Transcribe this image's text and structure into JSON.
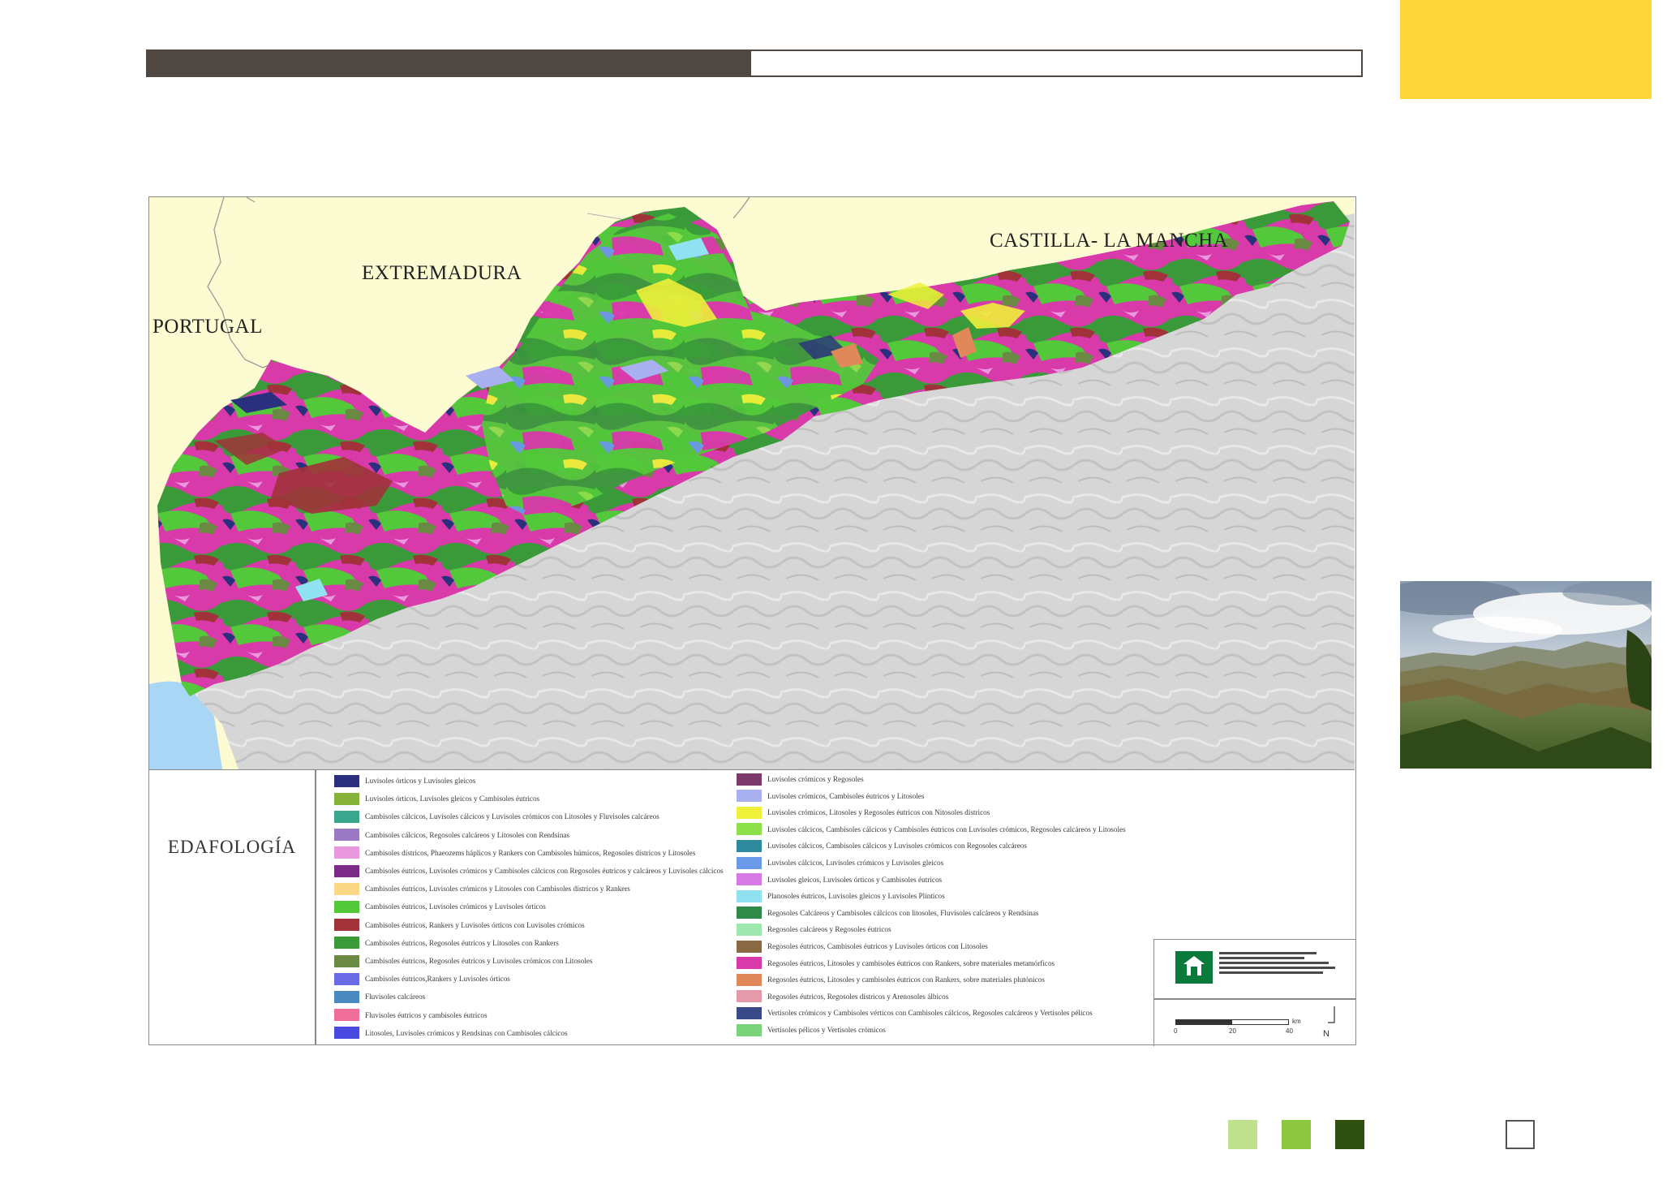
{
  "page": {
    "colors": {
      "top_bar_dark": "#4e4742",
      "accent_yellow": "#fed63a",
      "square_light": "#bfe08c",
      "square_mid": "#8dc63f",
      "square_dark": "#2f5011"
    },
    "top_progress": 0.497
  },
  "map": {
    "labels": {
      "portugal": "PORTUGAL",
      "extremadura": "EXTREMADURA",
      "castilla": "CASTILLA- LA MANCHA"
    },
    "colors": {
      "neighbour_land": "#fdfbd2",
      "sea": "#a9d6f5",
      "relief": "#d7d7d7"
    }
  },
  "legend": {
    "title": "EDAFOLOGÍA",
    "left": [
      {
        "label": "Luvisoles órticos y Luvisoles gleicos",
        "color": "#2a2f7e"
      },
      {
        "label": "Luvisoles órticos, Luvisoles gleicos y Cambisoles éutricos",
        "color": "#86b23a"
      },
      {
        "label": "Cambisoles cálcicos, Luvisoles cálcicos y Luvisoles crómicos con Litosoles y Fluvisoles calcáreos",
        "color": "#3aa68c"
      },
      {
        "label": "Cambisoles cálcicos, Regosoles calcáreos y Litosoles con Rendsinas",
        "color": "#9a7ac2"
      },
      {
        "label": "Cambisoles dístricos, Phaeozems háplicos y Rankers con Cambisoles húmicos, Regosoles dístricos y Litosoles",
        "color": "#ea98de"
      },
      {
        "label": "Cambisoles éutricos, Luvisoles crómicos y Cambisoles cálcicos con Regosoles éutricos y calcáreos y Luvisoles cálcicos",
        "color": "#7b2a88"
      },
      {
        "label": "Cambisoles éutricos, Luvisoles crómicos y Litosoles con Cambisoles dístricos y Rankers",
        "color": "#fbd886"
      },
      {
        "label": "Cambisoles éutricos, Luvisoles crómicos y Luvisoles órticos",
        "color": "#52c83a"
      },
      {
        "label": "Cambisoles éutricos, Rankers y Luvisoles órticos con Luvisoles crómicos",
        "color": "#a1323a"
      },
      {
        "label": "Cambisoles éutricos, Regosoles éutricos y Litosoles con Rankers",
        "color": "#3a9a3a"
      },
      {
        "label": "Cambisoles éutricos, Regosoles éutricos y Luvisoles crómicos con Litosoles",
        "color": "#6a8a44"
      },
      {
        "label": "Cambisoles éutricos,Rankers y Luvisoles órticos",
        "color": "#6a6ae6"
      },
      {
        "label": "Fluvisoles calcáreos",
        "color": "#4a8ac0"
      },
      {
        "label": "Fluvisoles éutricos y cambisoles éutricos",
        "color": "#ef6f9a"
      },
      {
        "label": "Litosoles, Luvisoles crómicos y Rendsinas con Cambisoles cálcicos",
        "color": "#4a4ae0"
      }
    ],
    "right": [
      {
        "label": "Luvisoles crómicos y Regosoles",
        "color": "#7c3a6a"
      },
      {
        "label": "Luvisoles crómicos, Cambisoles éutricos y Litosoles",
        "color": "#a9b0ef"
      },
      {
        "label": "Luvisoles crómicos, Litosoles y Regosoles  éutricos con Nitosoles dístricos",
        "color": "#eef03a"
      },
      {
        "label": "Luvisoles cálcicos, Cambisoles cálcicos y Cambisoles éutricos con  Luvisoles crómicos, Regosoles calcáreos y Litosoles",
        "color": "#8ee04a"
      },
      {
        "label": "Luvisoles cálcicos, Cambisoles cálcicos y Luvisoles crómicos con Regosoles calcáreos",
        "color": "#2f8a9e"
      },
      {
        "label": "Luvisoles cálcicos, Luvisoles crómicos y  Luvisoles gleicos",
        "color": "#6a9ae8"
      },
      {
        "label": "Luvisoles gleicos, Luvisoles órticos y Cambisoles éutricos",
        "color": "#d87ae6"
      },
      {
        "label": "Planosoles éutricos, Luvisoles gleicos y Luvisoles Plínticos",
        "color": "#90e2f0"
      },
      {
        "label": "Regosoles Calcáreos y Cambisoles cálcicos con litosoles, Fluvisoles calcáreos y Rendsinas",
        "color": "#2f8a4a"
      },
      {
        "label": "Regosoles calcáreos y Regosoles éutricos",
        "color": "#9ee8b0"
      },
      {
        "label": "Regosoles éutricos, Cambisoles éutricos y Luvisoles órticos con Litosoles",
        "color": "#8a6a44"
      },
      {
        "label": "Regosoles éutricos, Litosoles y cambisoles éutricos con Rankers, sobre materiales metamórficos",
        "color": "#d83aaa"
      },
      {
        "label": "Regosoles éutricos, Litosoles y cambisoles éutricos con Rankers, sobre materiales plutónicos",
        "color": "#e0885a"
      },
      {
        "label": "Regosoles éutricos, Regosoles dístricos y Arenosoles álbicos",
        "color": "#e49aaa"
      },
      {
        "label": "Vertisoles crómicos y Cambisoles vérticos con Cambisoles cálcicos, Regosoles calcáreos y Vertisoles pélicos",
        "color": "#3a4a88"
      },
      {
        "label": "Vertisoles pélicos y Vertisoles crómicos",
        "color": "#7ad27a"
      }
    ]
  },
  "scale_bar": {
    "ticks": [
      "0",
      "20",
      "40"
    ],
    "unit": "km",
    "north": "N"
  }
}
